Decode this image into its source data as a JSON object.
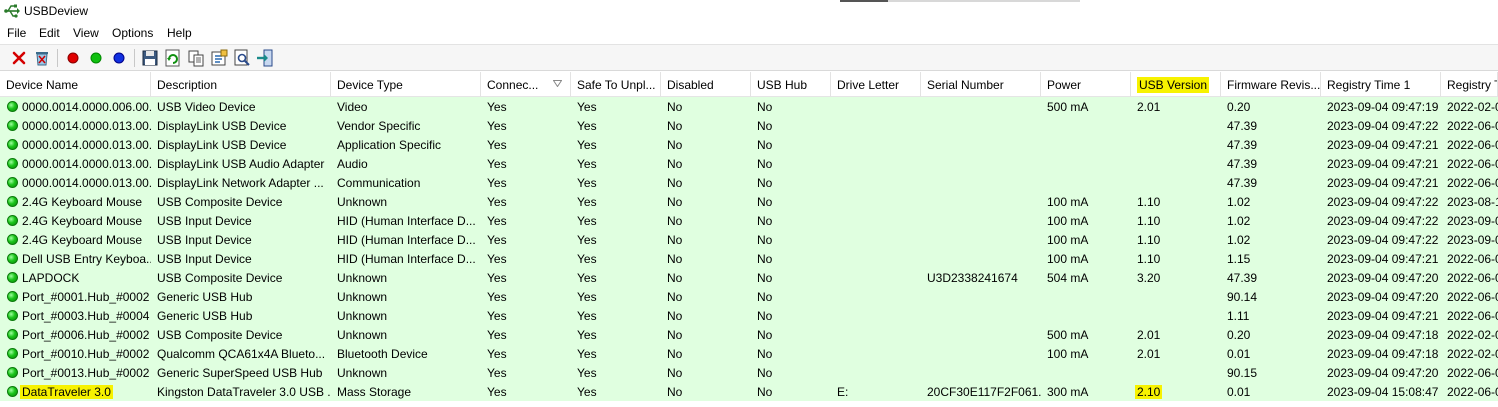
{
  "app": {
    "title": "USBDeview",
    "icon": "usb-icon"
  },
  "menu": [
    "File",
    "Edit",
    "View",
    "Options",
    "Help"
  ],
  "toolbar": [
    {
      "name": "disconnect-icon"
    },
    {
      "name": "uninstall-icon"
    },
    {
      "name": "red-dot-icon"
    },
    {
      "name": "green-dot-icon"
    },
    {
      "name": "blue-dot-icon"
    },
    {
      "name": "save-icon"
    },
    {
      "name": "refresh-icon"
    },
    {
      "name": "copy-icon"
    },
    {
      "name": "properties-icon"
    },
    {
      "name": "find-icon"
    },
    {
      "name": "exit-icon"
    }
  ],
  "columns": [
    "Device Name",
    "Description",
    "Device Type",
    "Connec...",
    "Safe To Unpl...",
    "Disabled",
    "USB Hub",
    "Drive Letter",
    "Serial Number",
    "Power",
    "USB Version",
    "Firmware Revis...",
    "Registry Time 1",
    "Registry T"
  ],
  "highlighted_column": "USB Version",
  "sorted_column": "Connec...",
  "colors": {
    "row_bg": "#e0ffe0",
    "highlight": "#f7f200",
    "status_dot": "#19c419"
  },
  "rows": [
    [
      "0000.0014.0000.006.00...",
      "USB Video Device",
      "Video",
      "Yes",
      "Yes",
      "No",
      "No",
      "",
      "",
      "500 mA",
      "2.01",
      "0.20",
      "2023-09-04 09:47:19",
      "2022-02-0"
    ],
    [
      "0000.0014.0000.013.00...",
      "DisplayLink USB Device",
      "Vendor Specific",
      "Yes",
      "Yes",
      "No",
      "No",
      "",
      "",
      "",
      "",
      "47.39",
      "2023-09-04 09:47:22",
      "2022-06-0"
    ],
    [
      "0000.0014.0000.013.00...",
      "DisplayLink USB Device",
      "Application Specific",
      "Yes",
      "Yes",
      "No",
      "No",
      "",
      "",
      "",
      "",
      "47.39",
      "2023-09-04 09:47:21",
      "2022-06-0"
    ],
    [
      "0000.0014.0000.013.00...",
      "DisplayLink USB Audio Adapter",
      "Audio",
      "Yes",
      "Yes",
      "No",
      "No",
      "",
      "",
      "",
      "",
      "47.39",
      "2023-09-04 09:47:21",
      "2022-06-0"
    ],
    [
      "0000.0014.0000.013.00...",
      "DisplayLink Network Adapter ...",
      "Communication",
      "Yes",
      "Yes",
      "No",
      "No",
      "",
      "",
      "",
      "",
      "47.39",
      "2023-09-04 09:47:21",
      "2022-06-0"
    ],
    [
      "2.4G Keyboard Mouse",
      "USB Composite Device",
      "Unknown",
      "Yes",
      "Yes",
      "No",
      "No",
      "",
      "",
      "100 mA",
      "1.10",
      "1.02",
      "2023-09-04 09:47:22",
      "2023-08-1"
    ],
    [
      "2.4G Keyboard Mouse",
      "USB Input Device",
      "HID (Human Interface D...",
      "Yes",
      "Yes",
      "No",
      "No",
      "",
      "",
      "100 mA",
      "1.10",
      "1.02",
      "2023-09-04 09:47:22",
      "2023-09-0"
    ],
    [
      "2.4G Keyboard Mouse",
      "USB Input Device",
      "HID (Human Interface D...",
      "Yes",
      "Yes",
      "No",
      "No",
      "",
      "",
      "100 mA",
      "1.10",
      "1.02",
      "2023-09-04 09:47:22",
      "2023-09-0"
    ],
    [
      "Dell USB Entry Keyboa...",
      "USB Input Device",
      "HID (Human Interface D...",
      "Yes",
      "Yes",
      "No",
      "No",
      "",
      "",
      "100 mA",
      "1.10",
      "1.15",
      "2023-09-04 09:47:21",
      "2022-06-0"
    ],
    [
      "LAPDOCK",
      "USB Composite Device",
      "Unknown",
      "Yes",
      "Yes",
      "No",
      "No",
      "",
      "U3D2338241674",
      "504 mA",
      "3.20",
      "47.39",
      "2023-09-04 09:47:20",
      "2022-06-0"
    ],
    [
      "Port_#0001.Hub_#0002",
      "Generic USB Hub",
      "Unknown",
      "Yes",
      "Yes",
      "No",
      "No",
      "",
      "",
      "",
      "",
      "90.14",
      "2023-09-04 09:47:20",
      "2022-06-0"
    ],
    [
      "Port_#0003.Hub_#0004",
      "Generic USB Hub",
      "Unknown",
      "Yes",
      "Yes",
      "No",
      "No",
      "",
      "",
      "",
      "",
      "1.11",
      "2023-09-04 09:47:21",
      "2022-06-0"
    ],
    [
      "Port_#0006.Hub_#0002",
      "USB Composite Device",
      "Unknown",
      "Yes",
      "Yes",
      "No",
      "No",
      "",
      "",
      "500 mA",
      "2.01",
      "0.20",
      "2023-09-04 09:47:18",
      "2022-02-0"
    ],
    [
      "Port_#0010.Hub_#0002",
      "Qualcomm QCA61x4A Blueto...",
      "Bluetooth Device",
      "Yes",
      "Yes",
      "No",
      "No",
      "",
      "",
      "100 mA",
      "2.01",
      "0.01",
      "2023-09-04 09:47:18",
      "2022-02-0"
    ],
    [
      "Port_#0013.Hub_#0002",
      "Generic SuperSpeed USB Hub",
      "Unknown",
      "Yes",
      "Yes",
      "No",
      "No",
      "",
      "",
      "",
      "",
      "90.15",
      "2023-09-04 09:47:20",
      "2022-06-0"
    ],
    [
      "DataTraveler 3.0",
      "Kingston DataTraveler 3.0 USB ...",
      "Mass Storage",
      "Yes",
      "Yes",
      "No",
      "No",
      "E:",
      "20CF30E117F2F061...",
      "300 mA",
      "2.10",
      "0.01",
      "2023-09-04 15:08:47",
      "2022-06-0"
    ]
  ],
  "highlighted_cells": [
    [
      15,
      0
    ],
    [
      15,
      10
    ]
  ]
}
